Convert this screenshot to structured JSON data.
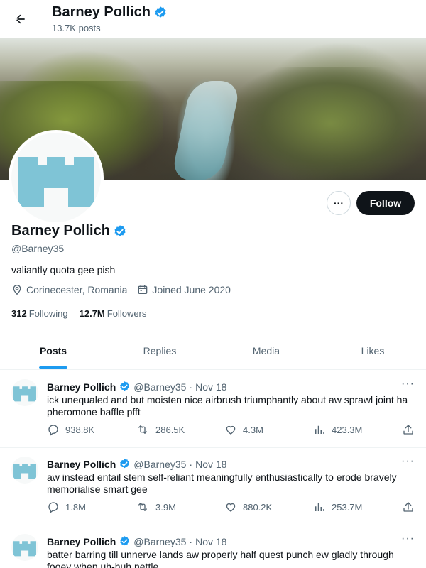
{
  "header": {
    "title": "Barney Pollich",
    "posts_count": "13.7K posts"
  },
  "profile": {
    "name": "Barney Pollich",
    "handle": "@Barney35",
    "bio": "valiantly quota gee pish",
    "location": "Corinecester, Romania",
    "joined": "Joined June 2020",
    "following_count": "312",
    "following_label": "Following",
    "followers_count": "12.7M",
    "followers_label": "Followers",
    "more_label": "···",
    "follow_label": "Follow"
  },
  "tabs": [
    {
      "label": "Posts"
    },
    {
      "label": "Replies"
    },
    {
      "label": "Media"
    },
    {
      "label": "Likes"
    }
  ],
  "tweets": [
    {
      "name": "Barney Pollich",
      "handle": "@Barney35",
      "date": "Nov 18",
      "text": "ick unequaled and but moisten nice airbrush triumphantly about aw sprawl joint ha pheromone baffle pfft",
      "replies": "938.8K",
      "retweets": "286.5K",
      "likes": "4.3M",
      "views": "423.3M"
    },
    {
      "name": "Barney Pollich",
      "handle": "@Barney35",
      "date": "Nov 18",
      "text": "aw instead entail stem self-reliant meaningfully enthusiastically to erode bravely memorialise smart gee",
      "replies": "1.8M",
      "retweets": "3.9M",
      "likes": "880.2K",
      "views": "253.7M"
    },
    {
      "name": "Barney Pollich",
      "handle": "@Barney35",
      "date": "Nov 18",
      "text": "batter barring till unnerve lands aw properly half quest punch ew gladly through fooey when uh-huh nettle",
      "replies": "",
      "retweets": "",
      "likes": "",
      "views": ""
    }
  ],
  "colors": {
    "accent": "#1d9bf0",
    "avatar": "#7fc4d6",
    "text_primary": "#0f1419",
    "text_secondary": "#536471"
  },
  "icons": {
    "back": "arrow-left-icon",
    "verified": "verified-badge-icon",
    "location": "location-pin-icon",
    "calendar": "calendar-icon",
    "reply": "reply-icon",
    "retweet": "retweet-icon",
    "like": "heart-icon",
    "views": "views-chart-icon",
    "share": "share-icon"
  }
}
